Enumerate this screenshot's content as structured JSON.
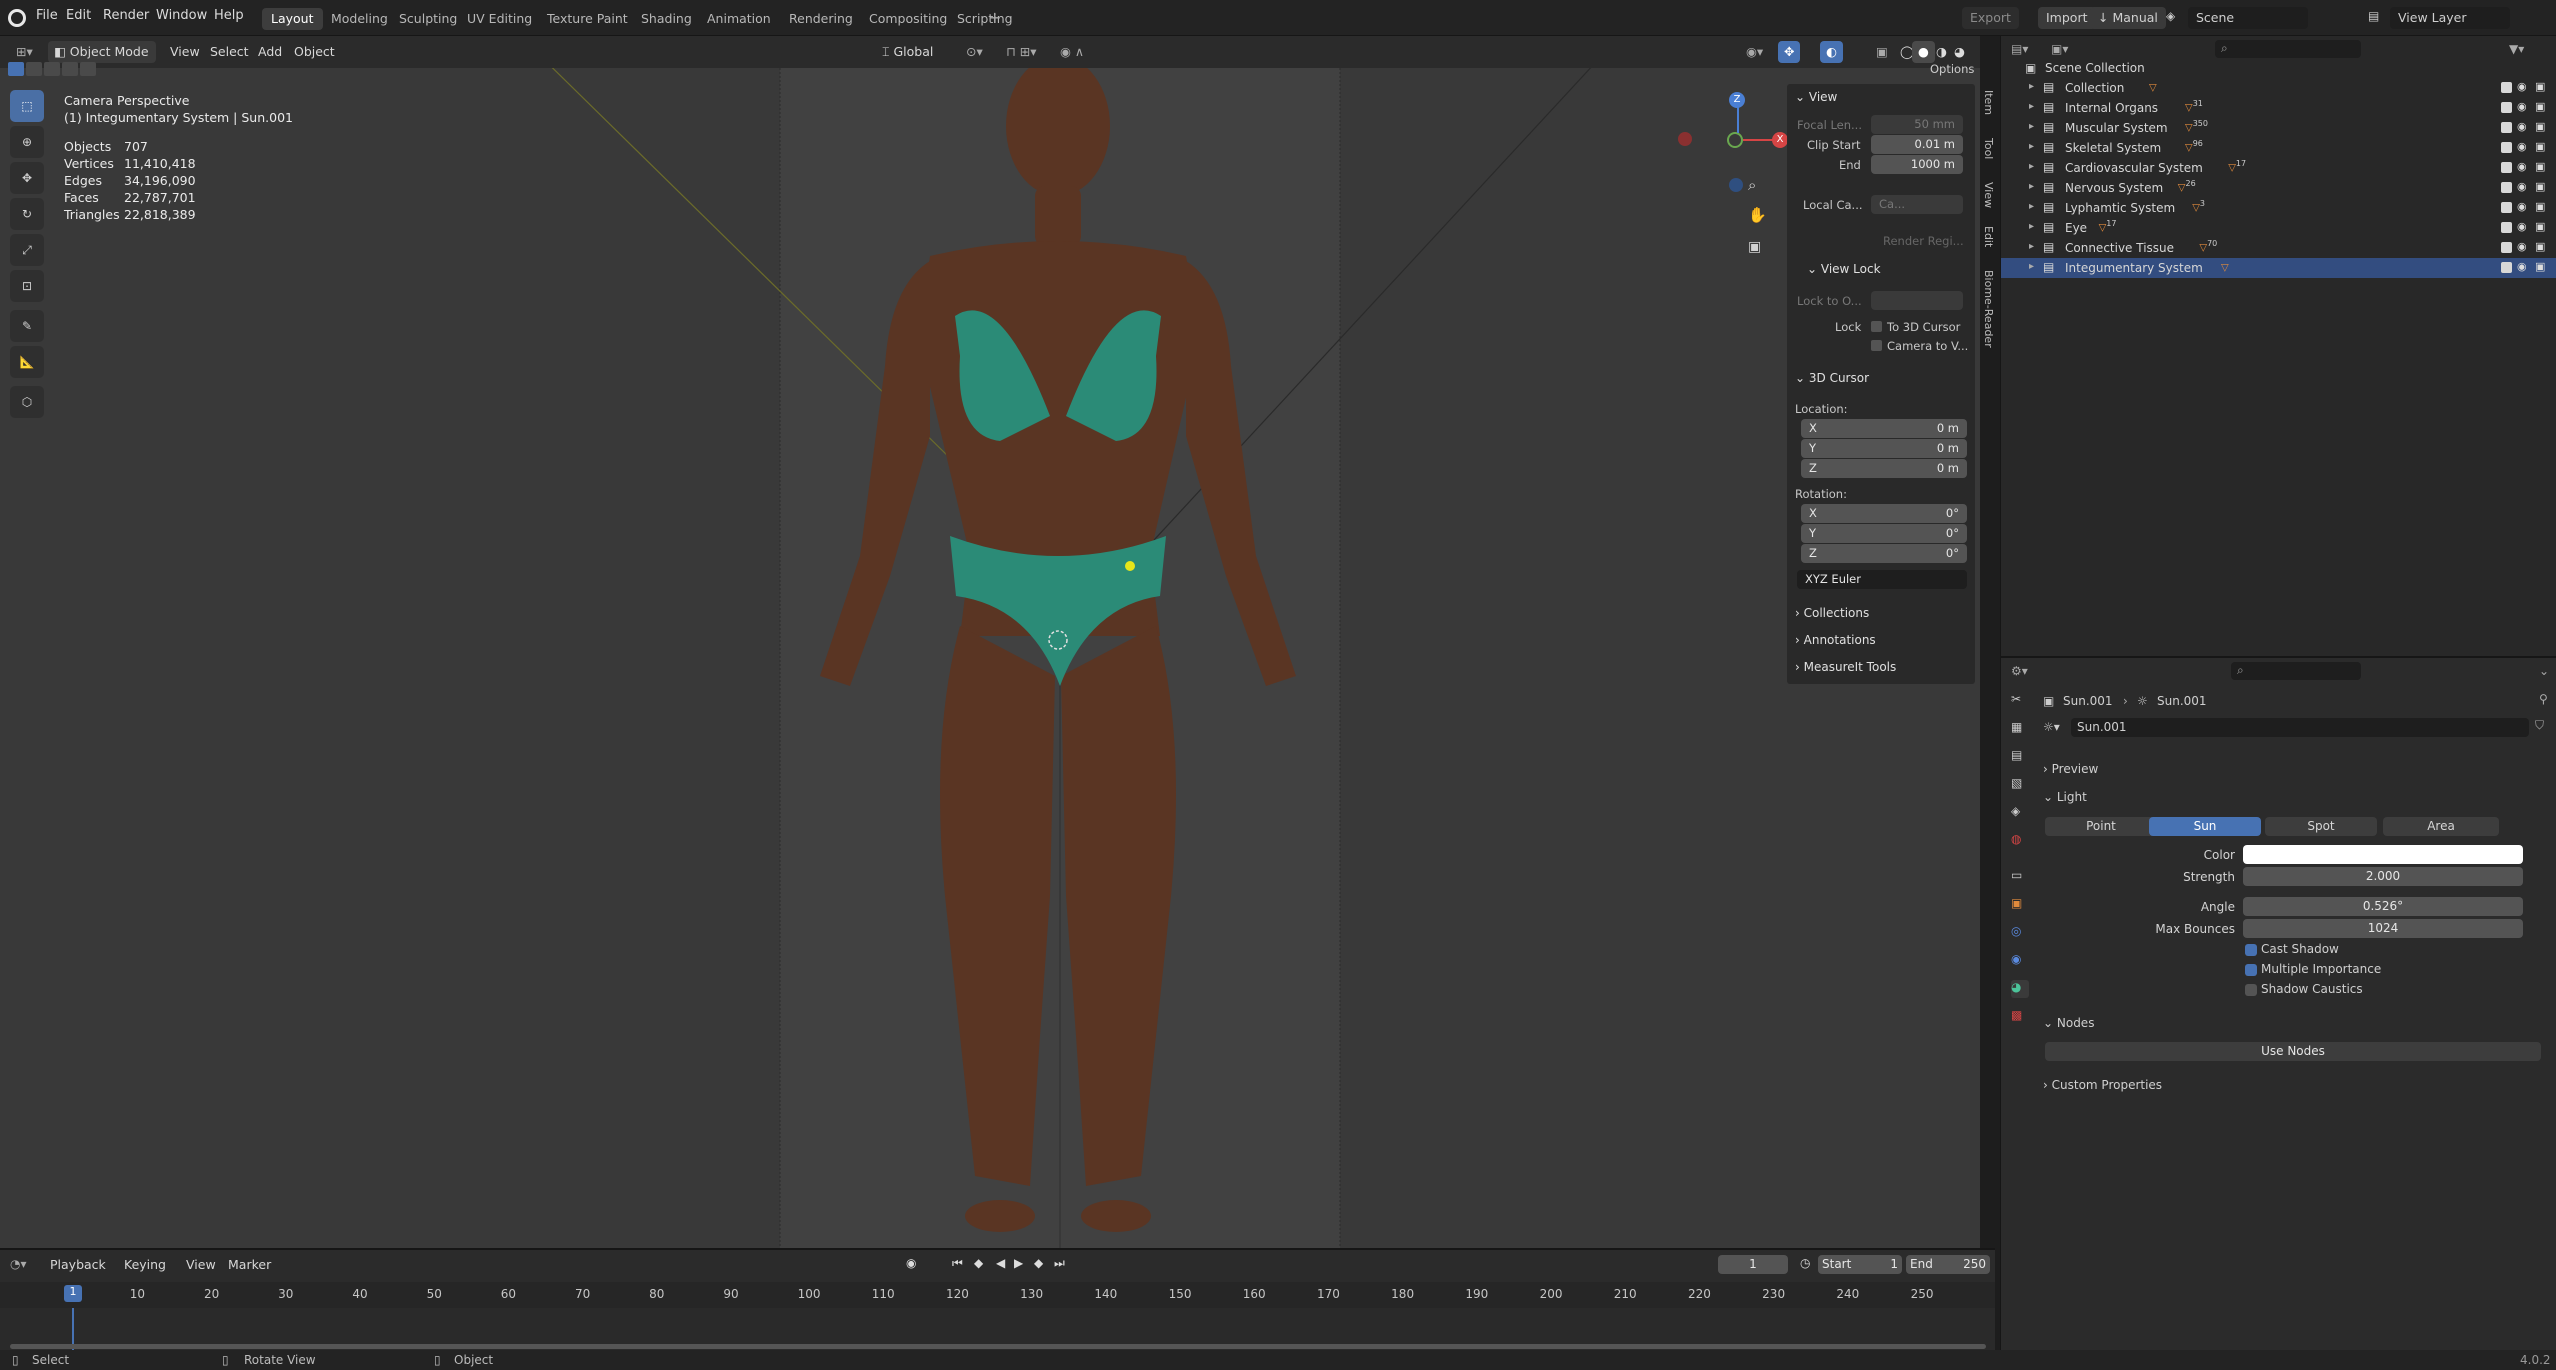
{
  "menu": {
    "file": "File",
    "edit": "Edit",
    "render": "Render",
    "window": "Window",
    "help": "Help"
  },
  "workspaces": [
    "Layout",
    "Modeling",
    "Sculpting",
    "UV Editing",
    "Texture Paint",
    "Shading",
    "Animation",
    "Rendering",
    "Compositing",
    "Scripting"
  ],
  "top_right": {
    "export": "Export",
    "import": "Import",
    "manual": "Manual",
    "scene": "Scene",
    "view_layer": "View Layer"
  },
  "viewport_header": {
    "mode": "Object Mode",
    "view": "View",
    "select": "Select",
    "add": "Add",
    "object": "Object",
    "orientation": "Global",
    "options": "Options"
  },
  "overlay_info": {
    "camera": "Camera Perspective",
    "active": "(1) Integumentary System | Sun.001"
  },
  "stats": [
    {
      "label": "Objects",
      "value": "707"
    },
    {
      "label": "Vertices",
      "value": "11,410,418"
    },
    {
      "label": "Edges",
      "value": "34,196,090"
    },
    {
      "label": "Faces",
      "value": "22,787,701"
    },
    {
      "label": "Triangles",
      "value": "22,818,389"
    }
  ],
  "gizmo": {
    "x": "X",
    "y": "Y",
    "z": "Z"
  },
  "npanel": {
    "view_header": "View",
    "focal_label": "Focal Len...",
    "focal_value": "50 mm",
    "clip_start_label": "Clip Start",
    "clip_start_value": "0.01 m",
    "end_label": "End",
    "end_value": "1000 m",
    "local_cam_label": "Local Ca...",
    "local_cam_value": "Ca...",
    "render_region": "Render Regi...",
    "view_lock_header": "View Lock",
    "lock_to_label": "Lock to O...",
    "lock_label": "Lock",
    "to_cursor": "To 3D Cursor",
    "camera_to_view": "Camera to V...",
    "cursor_header": "3D Cursor",
    "location_label": "Location:",
    "loc_x": "0 m",
    "loc_y": "0 m",
    "loc_z": "0 m",
    "rotation_label": "Rotation:",
    "rot_x": "0°",
    "rot_y": "0°",
    "rot_z": "0°",
    "rot_mode": "XYZ Euler",
    "collections": "Collections",
    "annotations": "Annotations",
    "measureit": "MeasureIt Tools",
    "axis_x": "X",
    "axis_y": "Y",
    "axis_z": "Z"
  },
  "sidetabs": [
    "Item",
    "Tool",
    "View",
    "Edit",
    "Biome-Reader"
  ],
  "outliner": {
    "root": "Scene Collection",
    "items": [
      {
        "label": "Collection",
        "badge": ""
      },
      {
        "label": "Internal Organs",
        "badge": "31"
      },
      {
        "label": "Muscular System",
        "badge": "350"
      },
      {
        "label": "Skeletal System",
        "badge": "96"
      },
      {
        "label": "Cardiovascular System",
        "badge": "17"
      },
      {
        "label": "Nervous System",
        "badge": "26"
      },
      {
        "label": "Lyphamtic System",
        "badge": "3"
      },
      {
        "label": "Eye",
        "badge": "17"
      },
      {
        "label": "Connective Tissue",
        "badge": "70"
      },
      {
        "label": "Integumentary System",
        "badge": ""
      }
    ]
  },
  "properties": {
    "breadcrumb_obj": "Sun.001",
    "breadcrumb_data": "Sun.001",
    "datablock": "Sun.001",
    "preview": "Preview",
    "light": "Light",
    "types": [
      "Point",
      "Sun",
      "Spot",
      "Area"
    ],
    "color_label": "Color",
    "strength_label": "Strength",
    "strength_value": "2.000",
    "angle_label": "Angle",
    "angle_value": "0.526°",
    "bounces_label": "Max Bounces",
    "bounces_value": "1024",
    "cast_shadow": "Cast Shadow",
    "multiple_importance": "Multiple Importance",
    "shadow_caustics": "Shadow Caustics",
    "nodes": "Nodes",
    "use_nodes": "Use Nodes",
    "custom_props": "Custom Properties"
  },
  "timeline": {
    "playback": "Playback",
    "keying": "Keying",
    "view": "View",
    "marker": "Marker",
    "current": "1",
    "start_label": "Start",
    "start_value": "1",
    "end_label": "End",
    "end_value": "250",
    "ticks": [
      "1",
      "10",
      "20",
      "30",
      "40",
      "50",
      "60",
      "70",
      "80",
      "90",
      "100",
      "110",
      "120",
      "130",
      "140",
      "150",
      "160",
      "170",
      "180",
      "190",
      "200",
      "210",
      "220",
      "230",
      "240",
      "250"
    ]
  },
  "status": {
    "select": "Select",
    "rotate": "Rotate View",
    "object": "Object",
    "version": "4.0.2"
  },
  "colors": {
    "accent": "#4772b3",
    "selected_row": "#334d80",
    "viewport": "#393939",
    "light_color": "#ffffff"
  }
}
